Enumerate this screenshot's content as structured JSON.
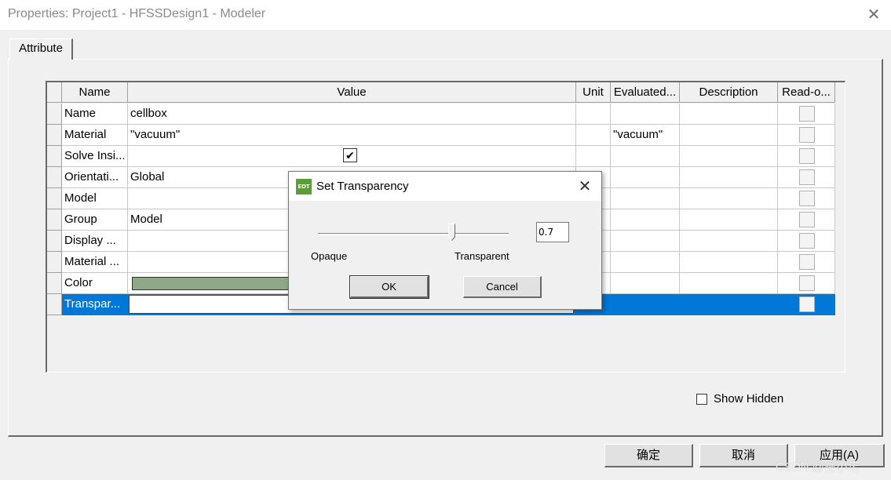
{
  "window": {
    "title": "Properties: Project1 - HFSSDesign1 - Modeler",
    "close_glyph": "✕"
  },
  "tab": {
    "label": "Attribute"
  },
  "table": {
    "headers": [
      "Name",
      "Value",
      "Unit",
      "Evaluated...",
      "Description",
      "Read-o..."
    ],
    "rows": [
      {
        "name": "Name",
        "value": "cellbox",
        "unit": "",
        "evaluated": "",
        "description": ""
      },
      {
        "name": "Material",
        "value": "\"vacuum\"",
        "unit": "",
        "evaluated": "\"vacuum\"",
        "description": ""
      },
      {
        "name": "Solve Insi...",
        "value": "",
        "unit": "",
        "evaluated": "",
        "description": "",
        "value_checked": true
      },
      {
        "name": "Orientati...",
        "value": "Global",
        "unit": "",
        "evaluated": "",
        "description": ""
      },
      {
        "name": "Model",
        "value": "",
        "unit": "",
        "evaluated": "",
        "description": ""
      },
      {
        "name": "Group",
        "value": "Model",
        "unit": "",
        "evaluated": "",
        "description": ""
      },
      {
        "name": "Display ...",
        "value": "",
        "unit": "",
        "evaluated": "",
        "description": ""
      },
      {
        "name": "Material ...",
        "value": "",
        "unit": "",
        "evaluated": "",
        "description": ""
      },
      {
        "name": "Color",
        "value": "",
        "unit": "",
        "evaluated": "",
        "description": "",
        "swatch_color": "#8fa888"
      },
      {
        "name": "Transpar...",
        "value": "",
        "unit": "",
        "evaluated": "",
        "description": "",
        "selected": true
      }
    ],
    "check_glyph": "✔"
  },
  "show_hidden": {
    "label": "Show Hidden",
    "checked": false
  },
  "buttons": {
    "ok": "确定",
    "cancel": "取消",
    "apply": "应用(A)"
  },
  "watermark": "CSDN @岳小诺",
  "dialog": {
    "title": "Set Transparency",
    "icon_text": "EDT",
    "close_glyph": "✕",
    "value": "0.7",
    "slider_value": 0.7,
    "min_label": "Opaque",
    "max_label": "Transparent",
    "ok": "OK",
    "cancel": "Cancel"
  },
  "colors": {
    "selection": "#0078d7",
    "swatch": "#8fa888",
    "icon": "#5a9e3a"
  }
}
